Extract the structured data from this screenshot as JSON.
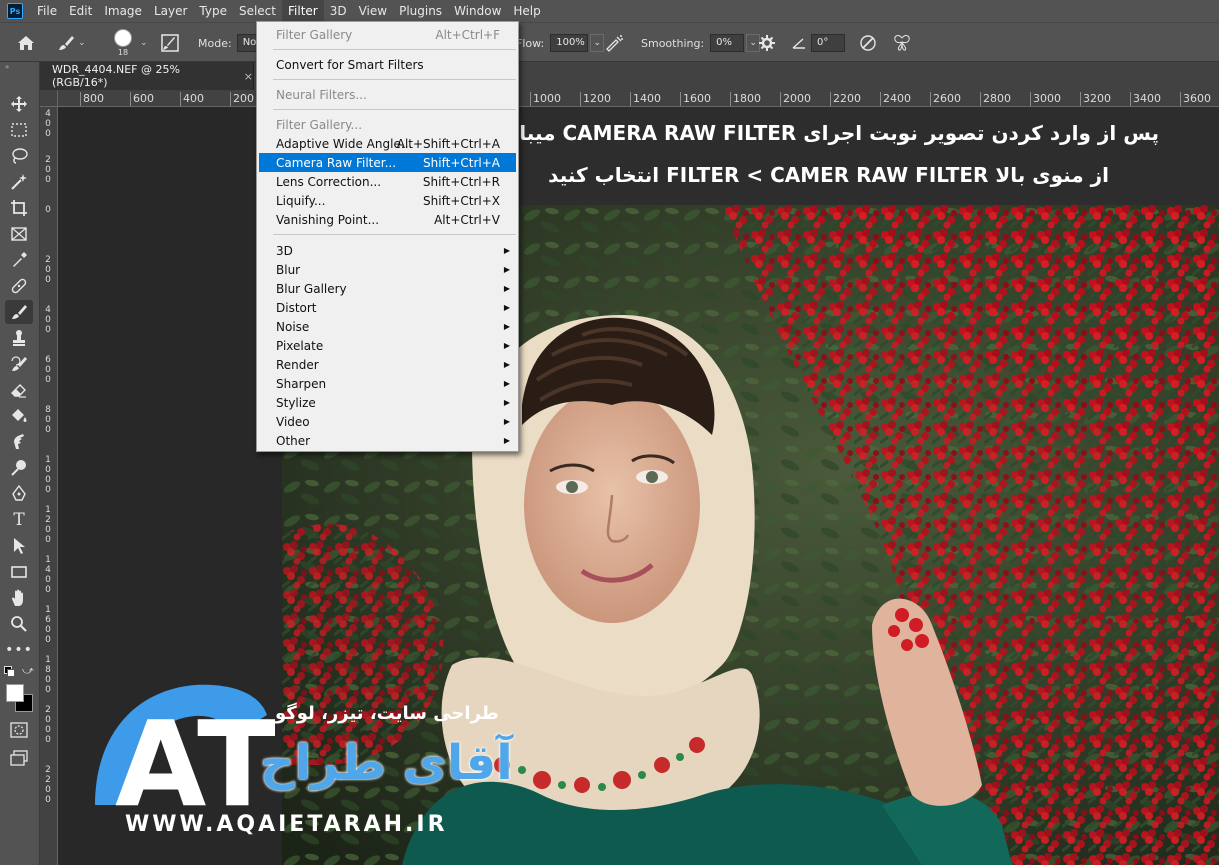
{
  "app": {
    "logo": "Ps"
  },
  "menubar": {
    "items": [
      "File",
      "Edit",
      "Image",
      "Layer",
      "Type",
      "Select",
      "Filter",
      "3D",
      "View",
      "Plugins",
      "Window",
      "Help"
    ],
    "active": "Filter"
  },
  "options": {
    "brush_size": "18",
    "mode_label": "Mode:",
    "mode_value": "Nor",
    "flow_label": "Flow:",
    "flow_value": "100%",
    "smoothing_label": "Smoothing:",
    "smoothing_value": "0%",
    "angle_value": "0°"
  },
  "document": {
    "tab_title": "WDR_4404.NEF @ 25% (RGB/16*)",
    "close_glyph": "×"
  },
  "ruler": {
    "h_left": [
      "800",
      "600",
      "400",
      "200"
    ],
    "h_right": [
      "1000",
      "1200",
      "1400",
      "1600",
      "1800",
      "2000",
      "2200",
      "2400",
      "2600",
      "2800",
      "3000",
      "3200",
      "3400",
      "3600"
    ],
    "v_labels": [
      "400",
      "200",
      "0",
      "200",
      "400",
      "600",
      "800",
      "1000",
      "1200",
      "1400",
      "1600",
      "1800",
      "2000",
      "2200"
    ]
  },
  "filter_menu": {
    "items": [
      {
        "label": "Filter Gallery",
        "shortcut": "Alt+Ctrl+F",
        "disabled": true
      },
      {
        "label": "Convert for Smart Filters",
        "shortcut": ""
      },
      {
        "label": "Neural Filters...",
        "shortcut": "",
        "disabled": true
      },
      {
        "label": "Filter Gallery...",
        "shortcut": "",
        "disabled": true
      },
      {
        "label": "Adaptive Wide Angle...",
        "shortcut": "Alt+Shift+Ctrl+A"
      },
      {
        "label": "Camera Raw Filter...",
        "shortcut": "Shift+Ctrl+A",
        "highlighted": true
      },
      {
        "label": "Lens Correction...",
        "shortcut": "Shift+Ctrl+R"
      },
      {
        "label": "Liquify...",
        "shortcut": "Shift+Ctrl+X"
      },
      {
        "label": "Vanishing Point...",
        "shortcut": "Alt+Ctrl+V"
      },
      {
        "label": "3D",
        "submenu": true
      },
      {
        "label": "Blur",
        "submenu": true
      },
      {
        "label": "Blur Gallery",
        "submenu": true
      },
      {
        "label": "Distort",
        "submenu": true
      },
      {
        "label": "Noise",
        "submenu": true
      },
      {
        "label": "Pixelate",
        "submenu": true
      },
      {
        "label": "Render",
        "submenu": true
      },
      {
        "label": "Sharpen",
        "submenu": true
      },
      {
        "label": "Stylize",
        "submenu": true
      },
      {
        "label": "Video",
        "submenu": true
      },
      {
        "label": "Other",
        "submenu": true
      }
    ]
  },
  "overlay": {
    "line1": "پس از وارد کردن تصویر نوبت اجرای  CAMERA RAW FILTER میباشد",
    "line2": "از منوی بالا  FILTER < CAMER RAW FILTER   انتخاب کنید"
  },
  "watermark": {
    "tagline": "طراحی سایت، تیزر، لوگو",
    "brand": "آقای طراح",
    "letters": "AT",
    "url": "WWW.AQAIETARAH.IR"
  },
  "colors": {
    "highlight": "#0078d7",
    "brand_blue": "#3d9be9"
  },
  "icons": [
    "home-icon",
    "brush-icon",
    "airbrush-icon",
    "symmetry-icon",
    "angle-icon",
    "pressure-icon",
    "butterfly-icon"
  ]
}
